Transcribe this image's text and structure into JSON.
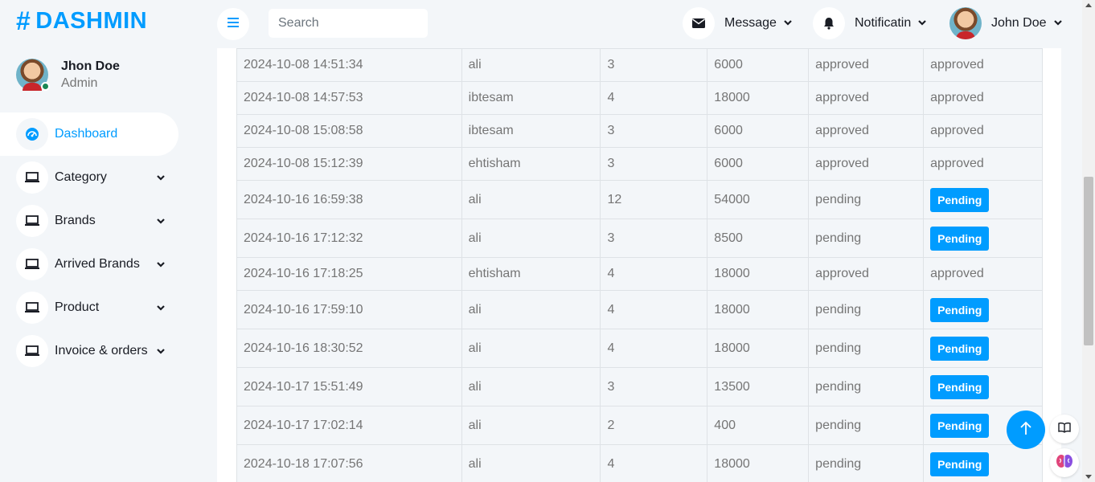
{
  "brand": {
    "name": "DASHMIN",
    "symbol": "#"
  },
  "profile": {
    "name": "Jhon Doe",
    "role": "Admin"
  },
  "sidebar": {
    "items": [
      {
        "label": "Dashboard",
        "icon": "dashboard-gauge-icon",
        "active": true
      },
      {
        "label": "Category",
        "icon": "laptop-icon"
      },
      {
        "label": "Brands",
        "icon": "laptop-icon"
      },
      {
        "label": "Arrived Brands",
        "icon": "laptop-icon"
      },
      {
        "label": "Product",
        "icon": "laptop-icon"
      },
      {
        "label": "Invoice & orders",
        "icon": "laptop-icon"
      }
    ]
  },
  "topbar": {
    "search_placeholder": "Search",
    "message_label": "Message",
    "notification_label": "Notificatin",
    "user_name": "John Doe"
  },
  "table": {
    "rows": [
      {
        "date": "2024-10-08 14:51:34",
        "user": "ali",
        "qty": "3",
        "amount": "6000",
        "status": "approved",
        "action": "approved",
        "pending": false
      },
      {
        "date": "2024-10-08 14:57:53",
        "user": "ibtesam",
        "qty": "4",
        "amount": "18000",
        "status": "approved",
        "action": "approved",
        "pending": false
      },
      {
        "date": "2024-10-08 15:08:58",
        "user": "ibtesam",
        "qty": "3",
        "amount": "6000",
        "status": "approved",
        "action": "approved",
        "pending": false
      },
      {
        "date": "2024-10-08 15:12:39",
        "user": "ehtisham",
        "qty": "3",
        "amount": "6000",
        "status": "approved",
        "action": "approved",
        "pending": false
      },
      {
        "date": "2024-10-16 16:59:38",
        "user": "ali",
        "qty": "12",
        "amount": "54000",
        "status": "pending",
        "action": "Pending",
        "pending": true
      },
      {
        "date": "2024-10-16 17:12:32",
        "user": "ali",
        "qty": "3",
        "amount": "8500",
        "status": "pending",
        "action": "Pending",
        "pending": true
      },
      {
        "date": "2024-10-16 17:18:25",
        "user": "ehtisham",
        "qty": "4",
        "amount": "18000",
        "status": "approved",
        "action": "approved",
        "pending": false
      },
      {
        "date": "2024-10-16 17:59:10",
        "user": "ali",
        "qty": "4",
        "amount": "18000",
        "status": "pending",
        "action": "Pending",
        "pending": true
      },
      {
        "date": "2024-10-16 18:30:52",
        "user": "ali",
        "qty": "4",
        "amount": "18000",
        "status": "pending",
        "action": "Pending",
        "pending": true
      },
      {
        "date": "2024-10-17 15:51:49",
        "user": "ali",
        "qty": "3",
        "amount": "13500",
        "status": "pending",
        "action": "Pending",
        "pending": true
      },
      {
        "date": "2024-10-17 17:02:14",
        "user": "ali",
        "qty": "2",
        "amount": "400",
        "status": "pending",
        "action": "Pending",
        "pending": true
      },
      {
        "date": "2024-10-18 17:07:56",
        "user": "ali",
        "qty": "4",
        "amount": "18000",
        "status": "pending",
        "action": "Pending",
        "pending": true
      }
    ]
  },
  "colors": {
    "primary": "#009cff",
    "background": "#f3f6f9",
    "text": "#757575",
    "dark": "#191c24"
  },
  "floating": {
    "back_to_top_icon": "arrow-up-icon",
    "side_icons": [
      "book-icon",
      "brain-icon"
    ]
  }
}
